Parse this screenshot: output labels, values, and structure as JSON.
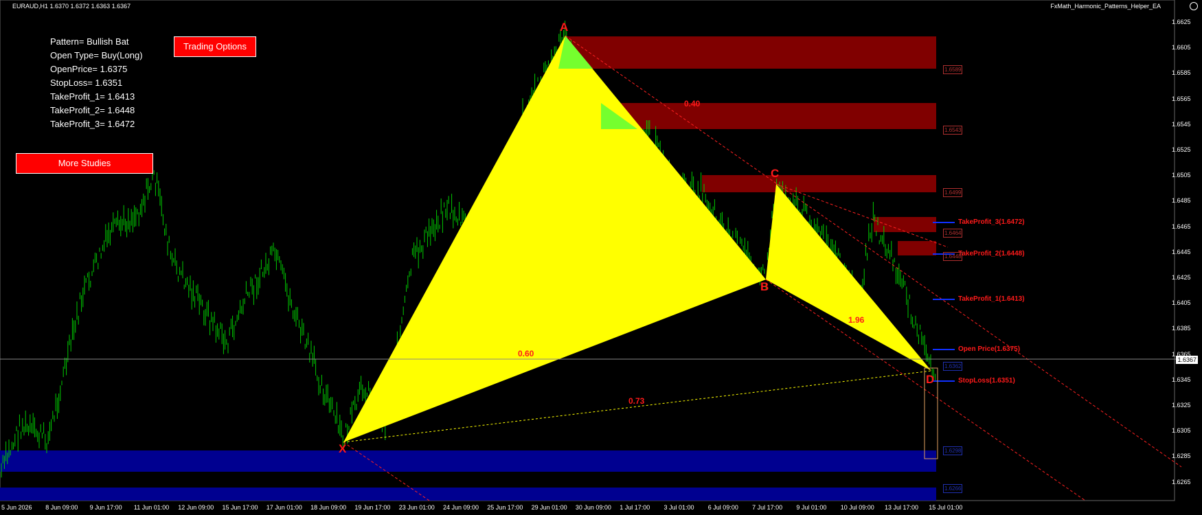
{
  "header": {
    "symbol_info": "EURAUD,H1  1.6370 1.6372 1.6363 1.6367",
    "ea_name": "FxMath_Harmonic_Patterns_Helper_EA"
  },
  "info_panel": {
    "pattern": "Pattern= Bullish Bat",
    "open_type": "Open Type= Buy(Long)",
    "open_price": "OpenPrice= 1.6375",
    "stop_loss": "StopLoss= 1.6351",
    "tp1": "TakeProfit_1= 1.6413",
    "tp2": "TakeProfit_2= 1.6448",
    "tp3": "TakeProfit_3= 1.6472"
  },
  "buttons": {
    "trading_options": "Trading Options",
    "more_studies": "More Studies"
  },
  "pattern_points": {
    "X": "X",
    "A": "A",
    "B": "B",
    "C": "C",
    "D": "D"
  },
  "ratios": {
    "xb": "0.60",
    "ac": "0.40",
    "bd": "1.96",
    "xd": "0.73"
  },
  "levels": {
    "tp3": "TakeProfit_3(1.6472)",
    "tp2": "TakeProfit_2(1.6448)",
    "tp1": "TakeProfit_1(1.6413)",
    "open": "Open Price(1.6375)",
    "sl": "StopLoss(1.6351)"
  },
  "zone_labels": {
    "z1": "1.6589",
    "z2": "1.6543",
    "z3": "1.6499",
    "z4": "1.6464",
    "z5": "1.6448",
    "z6": "1.6362",
    "z7": "1.6298",
    "z8": "1.6266"
  },
  "current_price": "1.6367",
  "y_axis": [
    "1.6625",
    "1.6605",
    "1.6585",
    "1.6565",
    "1.6545",
    "1.6525",
    "1.6505",
    "1.6485",
    "1.6465",
    "1.6445",
    "1.6425",
    "1.6405",
    "1.6385",
    "1.6365",
    "1.6345",
    "1.6325",
    "1.6305",
    "1.6285",
    "1.6265"
  ],
  "x_axis": [
    "5 Jun 2026",
    "8 Jun 09:00",
    "9 Jun 17:00",
    "11 Jun 01:00",
    "12 Jun 09:00",
    "15 Jun 17:00",
    "17 Jun 01:00",
    "18 Jun 09:00",
    "19 Jun 17:00",
    "23 Jun 01:00",
    "24 Jun 09:00",
    "25 Jun 17:00",
    "29 Jun 01:00",
    "30 Jun 09:00",
    "1 Jul 17:00",
    "3 Jul 01:00",
    "6 Jul 09:00",
    "7 Jul 17:00",
    "9 Jul 01:00",
    "10 Jul 09:00",
    "13 Jul 17:00",
    "15 Jul 01:00"
  ],
  "colors": {
    "background": "#000000",
    "candles": "#00cc00",
    "pattern_fill": "#ffff00",
    "resistance_zone": "#800000",
    "support_zone": "#000090",
    "label_red": "#ff1a1a"
  }
}
